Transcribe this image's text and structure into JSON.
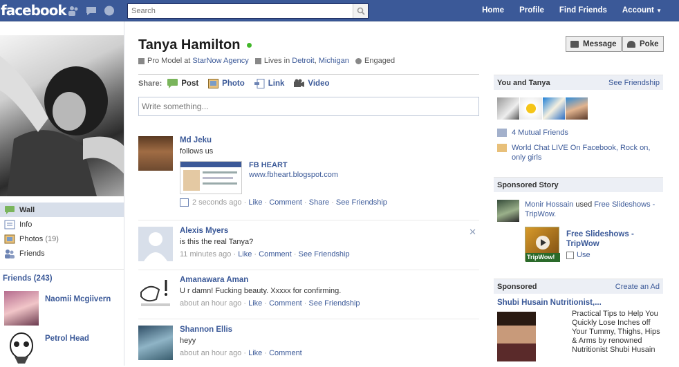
{
  "topbar": {
    "logo": "facebook",
    "search_placeholder": "Search",
    "nav": [
      "Home",
      "Profile",
      "Find Friends",
      "Account"
    ]
  },
  "left": {
    "nav": [
      {
        "label": "Wall",
        "icon": "wall-icon",
        "active": true
      },
      {
        "label": "Info",
        "icon": "info-icon"
      },
      {
        "label": "Photos",
        "count": "(19)",
        "icon": "photos-icon"
      },
      {
        "label": "Friends",
        "icon": "friends-icon"
      }
    ],
    "friends_title": "Friends (243)",
    "friends": [
      {
        "name": "Naomii Mcgiivern"
      },
      {
        "name": "Petrol Head"
      }
    ]
  },
  "profile": {
    "name": "Tanya Hamilton",
    "info": {
      "job_prefix": "Pro Model at ",
      "job_company": "StarNow Agency",
      "lives_prefix": "Lives in ",
      "city": "Detroit",
      "state": "Michigan",
      "relationship": "Engaged"
    },
    "buttons": {
      "message": "Message",
      "poke": "Poke"
    }
  },
  "share": {
    "label": "Share:",
    "items": [
      "Post",
      "Photo",
      "Link",
      "Video"
    ],
    "placeholder": "Write something..."
  },
  "stories": [
    {
      "author": "Md Jeku",
      "text": "follows us",
      "link_title": "FB HEART",
      "link_url": "www.fbheart.blogspot.com",
      "time": "2 seconds ago",
      "actions": [
        "Like",
        "Comment",
        "Share",
        "See Friendship"
      ]
    },
    {
      "author": "Alexis Myers",
      "text": "is this the real Tanya?",
      "time": "11 minutes ago",
      "actions": [
        "Like",
        "Comment",
        "See Friendship"
      ]
    },
    {
      "author": "Amanawara Aman",
      "text": "U r damn! Fucking beauty. Xxxxx for confirming.",
      "time": "about an hour ago",
      "actions": [
        "Like",
        "Comment",
        "See Friendship"
      ]
    },
    {
      "author": "Shannon Ellis",
      "text": "heyy",
      "time": "about an hour ago",
      "actions": [
        "Like",
        "Comment"
      ]
    }
  ],
  "right": {
    "you_and": {
      "title": "You and Tanya",
      "link": "See Friendship",
      "mutual": "4 Mutual Friends",
      "page_prefix": "World Chat LIVE On Facebook",
      "page_mid": "Rock on",
      "page_suffix": "only girls"
    },
    "sponsored_story": {
      "title": "Sponsored Story",
      "user": "Monir Hossain",
      "used": "used",
      "app": "Free Slideshows - TripWow.",
      "app_title": "Free Slideshows - TripWow",
      "use": "Use",
      "thumb_text": "TripWow!"
    },
    "sponsored": {
      "title": "Sponsored",
      "link": "Create an Ad",
      "ad_title": "Shubi Husain Nutritionist,...",
      "ad_text": "Practical Tips to Help You Quickly Lose Inches off Your Tummy, Thighs, Hips & Arms by renowned Nutritionist Shubi Husain"
    }
  },
  "colors": {
    "brand": "#3b5998",
    "online": "#42b72a"
  }
}
